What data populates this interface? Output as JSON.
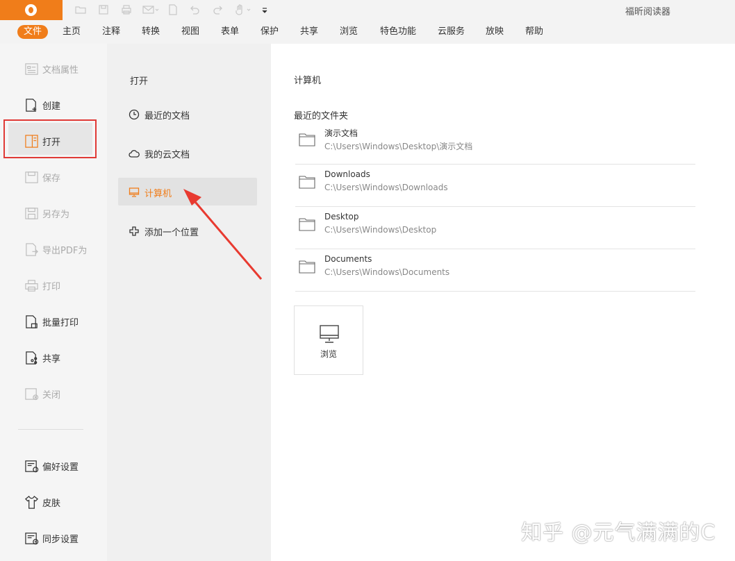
{
  "app": {
    "title": "福昕阅读器"
  },
  "ribbon": {
    "tabs": [
      {
        "label": "文件",
        "active": true
      },
      {
        "label": "主页"
      },
      {
        "label": "注释"
      },
      {
        "label": "转换"
      },
      {
        "label": "视图"
      },
      {
        "label": "表单"
      },
      {
        "label": "保护"
      },
      {
        "label": "共享"
      },
      {
        "label": "浏览"
      },
      {
        "label": "特色功能"
      },
      {
        "label": "云服务"
      },
      {
        "label": "放映"
      },
      {
        "label": "帮助"
      }
    ]
  },
  "backstage": {
    "items": [
      {
        "label": "文档属性",
        "icon": "document-properties-icon",
        "enabled": false
      },
      {
        "label": "创建",
        "icon": "create-icon",
        "enabled": true
      },
      {
        "label": "打开",
        "icon": "open-icon",
        "enabled": true,
        "selected": true
      },
      {
        "label": "保存",
        "icon": "save-icon",
        "enabled": false
      },
      {
        "label": "另存为",
        "icon": "save-as-icon",
        "enabled": false
      },
      {
        "label": "导出PDF为",
        "icon": "export-pdf-icon",
        "enabled": false
      },
      {
        "label": "打印",
        "icon": "print-icon",
        "enabled": false
      },
      {
        "label": "批量打印",
        "icon": "batch-print-icon",
        "enabled": true
      },
      {
        "label": "共享",
        "icon": "share-icon",
        "enabled": true
      },
      {
        "label": "关闭",
        "icon": "close-doc-icon",
        "enabled": false
      },
      {
        "label": "偏好设置",
        "icon": "preferences-icon",
        "enabled": true
      },
      {
        "label": "皮肤",
        "icon": "skin-icon",
        "enabled": true
      },
      {
        "label": "同步设置",
        "icon": "sync-settings-icon",
        "enabled": true
      }
    ]
  },
  "open_panel": {
    "title": "打开",
    "locations": [
      {
        "label": "最近的文档",
        "icon": "clock-icon"
      },
      {
        "label": "我的云文档",
        "icon": "cloud-icon"
      },
      {
        "label": "计算机",
        "icon": "computer-icon",
        "selected": true
      },
      {
        "label": "添加一个位置",
        "icon": "plus-icon"
      }
    ]
  },
  "computer": {
    "title": "计算机",
    "recent_label": "最近的文件夹",
    "folders": [
      {
        "name": "演示文档",
        "path": "C:\\Users\\Windows\\Desktop\\演示文档"
      },
      {
        "name": "Downloads",
        "path": "C:\\Users\\Windows\\Downloads"
      },
      {
        "name": "Desktop",
        "path": "C:\\Users\\Windows\\Desktop"
      },
      {
        "name": "Documents",
        "path": "C:\\Users\\Windows\\Documents"
      }
    ],
    "browse_label": "浏览"
  },
  "watermark": "知乎 @元气满满的C",
  "colors": {
    "accent": "#f07d1a",
    "highlight_box": "#e03a36",
    "arrow": "#e83a30"
  }
}
